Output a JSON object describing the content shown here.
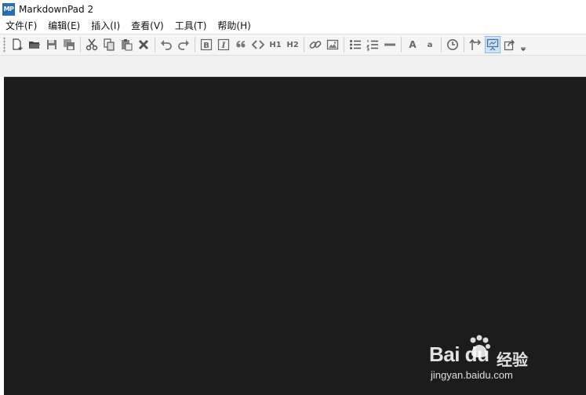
{
  "window": {
    "title": "MarkdownPad 2",
    "logo_text": "MP"
  },
  "menu": [
    {
      "label": "文件(F)"
    },
    {
      "label": "编辑(E)"
    },
    {
      "label": "插入(I)"
    },
    {
      "label": "查看(V)"
    },
    {
      "label": "工具(T)"
    },
    {
      "label": "帮助(H)"
    }
  ],
  "toolbar": {
    "h1_label": "H1",
    "h2_label": "H2",
    "font_big_label": "A",
    "font_small_label": "a",
    "bold_label": "B",
    "italic_label": "I",
    "active_button": "preview-toggle"
  },
  "editor": {
    "content": "",
    "background": "#1c1c1c"
  },
  "watermark": {
    "brand": "Bai du",
    "sub": "经验",
    "url": "jingyan.baidu.com"
  }
}
